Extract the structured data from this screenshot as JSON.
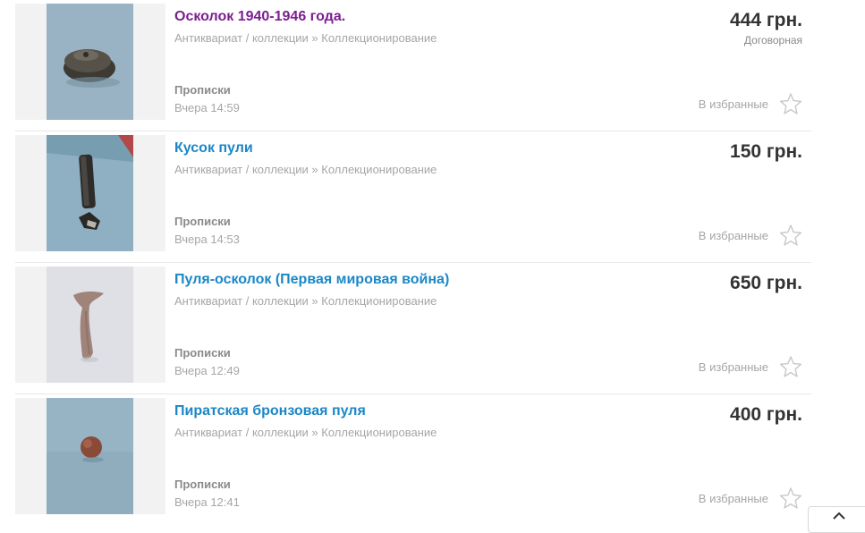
{
  "listings": [
    {
      "title": "Осколок 1940-1946 года.",
      "category": "Антиквариат / коллекции » Коллекционирование",
      "price": "444 грн.",
      "price_note": "Договорная",
      "location": "Прописки",
      "time": "Вчера 14:59",
      "favorite_label": "В избранные",
      "visited": true
    },
    {
      "title": "Кусок пули",
      "category": "Антиквариат / коллекции » Коллекционирование",
      "price": "150 грн.",
      "price_note": "",
      "location": "Прописки",
      "time": "Вчера 14:53",
      "favorite_label": "В избранные",
      "visited": false
    },
    {
      "title": "Пуля-осколок (Первая мировая война)",
      "category": "Антиквариат / коллекции » Коллекционирование",
      "price": "650 грн.",
      "price_note": "",
      "location": "Прописки",
      "time": "Вчера 12:49",
      "favorite_label": "В избранные",
      "visited": false
    },
    {
      "title": "Пиратская бронзовая пуля",
      "category": "Антиквариат / коллекции » Коллекционирование",
      "price": "400 грн.",
      "price_note": "",
      "location": "Прописки",
      "time": "Вчера 12:41",
      "favorite_label": "В избранные",
      "visited": false
    }
  ],
  "colors": {
    "link": "#1b87c6",
    "visited_link": "#7b1e8e",
    "price": "#333333",
    "muted": "#a6a6a6"
  },
  "icons": {
    "favorite": "star-outline-icon",
    "scroll_top": "chevron-up-icon"
  }
}
